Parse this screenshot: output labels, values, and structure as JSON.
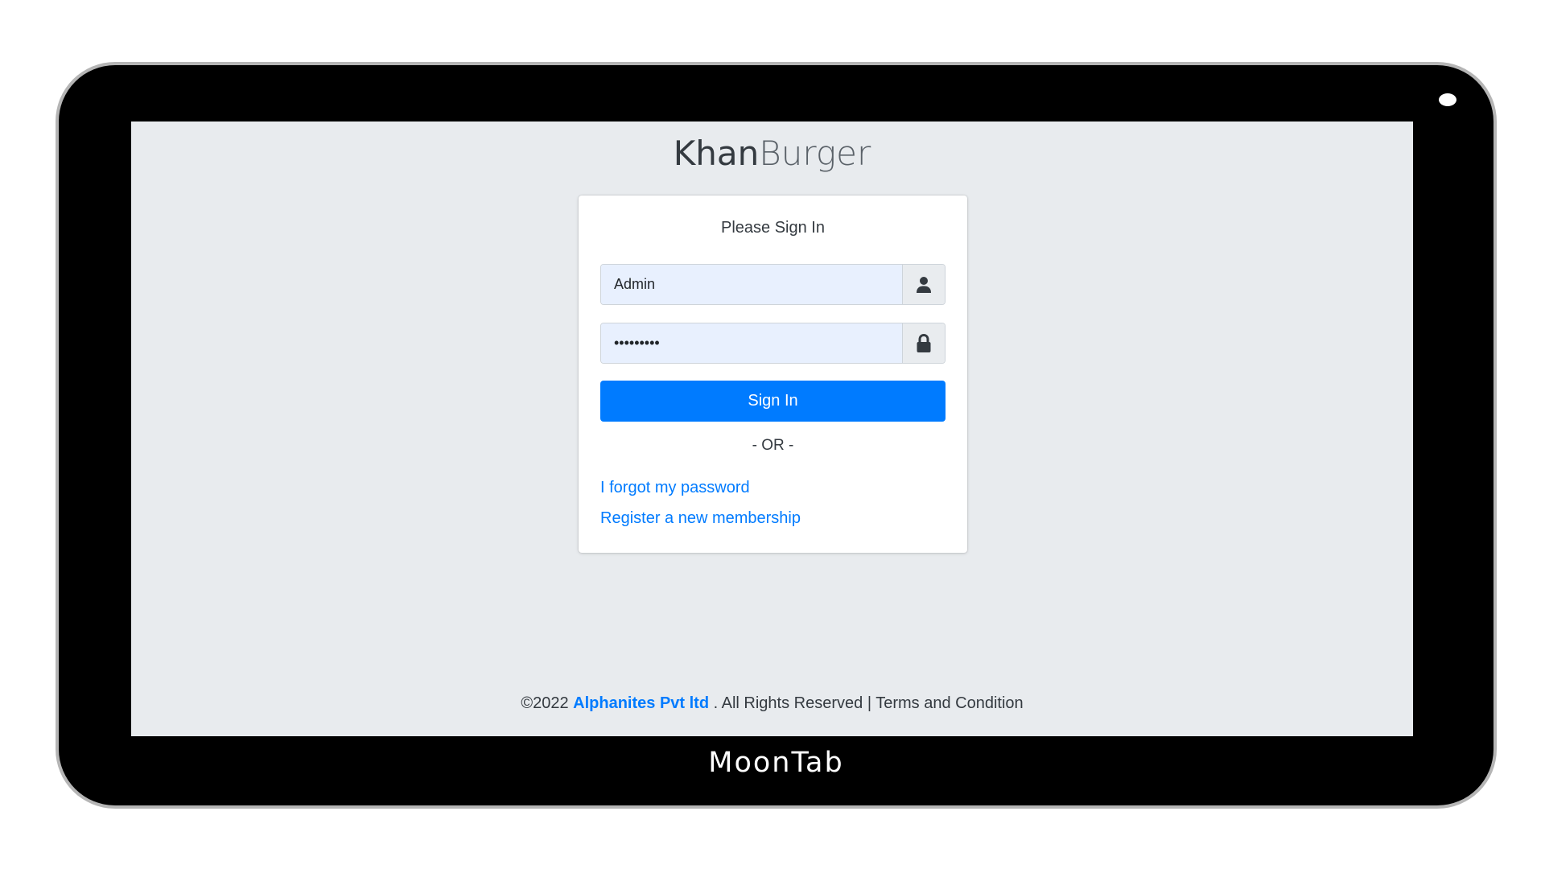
{
  "device": {
    "brand_label": "MoonTab"
  },
  "app": {
    "logo_strong": "Khan",
    "logo_light": "Burger"
  },
  "login": {
    "title": "Please Sign In",
    "username_value": "Admin",
    "username_icon": "user-icon",
    "password_value": "•••••••••",
    "password_icon": "lock-icon",
    "signin_label": "Sign In",
    "or_text": "- OR -",
    "forgot_link": "I forgot my password",
    "register_link": "Register a new membership"
  },
  "footer": {
    "copyright": "©2022",
    "company": "Alphanites Pvt ltd",
    "rights": ". All Rights Reserved | Terms and Condition"
  },
  "colors": {
    "accent": "#007bff",
    "screen_bg": "#e8ebee",
    "input_bg": "#e8f0fe",
    "device_frame": "#000000"
  }
}
